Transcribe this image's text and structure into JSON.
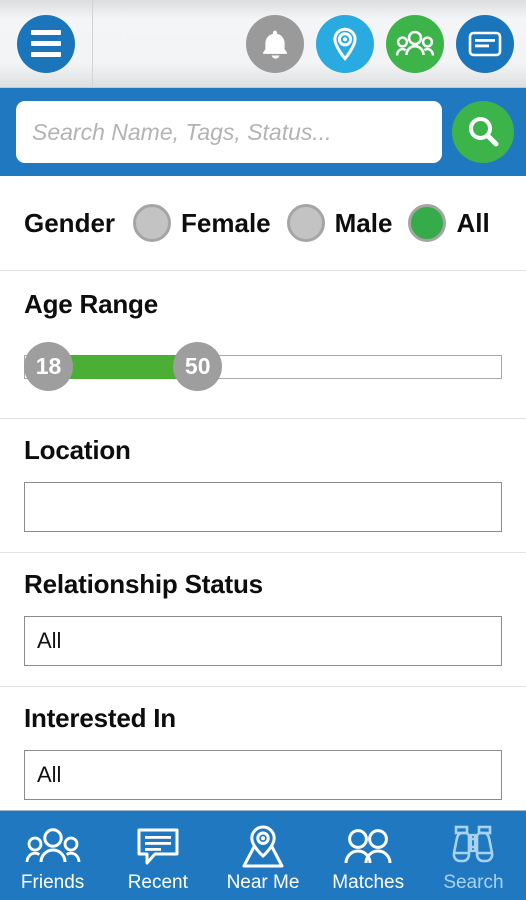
{
  "header": {
    "menu_button": "menu",
    "icons": [
      {
        "name": "notifications-icon",
        "glyph": "bell",
        "color": "#9a9a9a"
      },
      {
        "name": "location-icon",
        "glyph": "map-pin",
        "color": "#29abe2"
      },
      {
        "name": "friends-icon",
        "glyph": "group",
        "color": "#3cb44a"
      },
      {
        "name": "messages-icon",
        "glyph": "message-card",
        "color": "#1b75bb"
      }
    ]
  },
  "search": {
    "placeholder": "Search Name, Tags, Status...",
    "value": "",
    "button_icon": "search-icon",
    "bar_color": "#2079c0",
    "button_color": "#3cb44a"
  },
  "filters": {
    "gender": {
      "label": "Gender",
      "options": [
        {
          "label": "Female",
          "selected": false
        },
        {
          "label": "Male",
          "selected": false
        },
        {
          "label": "All",
          "selected": true
        }
      ],
      "selected_color": "#35ab49"
    },
    "age_range": {
      "title": "Age Range",
      "min_value": "18",
      "max_value": "50",
      "scale_min": 18,
      "scale_max": 110,
      "fill_color": "#4caf35",
      "knob_color": "#9e9e9e"
    },
    "location": {
      "title": "Location",
      "value": "",
      "placeholder": ""
    },
    "relationship_status": {
      "title": "Relationship Status",
      "value": "All"
    },
    "interested_in": {
      "title": "Interested In",
      "value": "All"
    }
  },
  "bottom_nav": {
    "bar_color": "#2079c0",
    "active_color": "#a8d3f0",
    "items": [
      {
        "label": "Friends",
        "icon": "group-icon",
        "active": false
      },
      {
        "label": "Recent",
        "icon": "chat-bubble-icon",
        "active": false
      },
      {
        "label": "Near Me",
        "icon": "map-pin-icon",
        "active": false
      },
      {
        "label": "Matches",
        "icon": "two-people-icon",
        "active": false
      },
      {
        "label": "Search",
        "icon": "binoculars-icon",
        "active": true
      }
    ]
  }
}
